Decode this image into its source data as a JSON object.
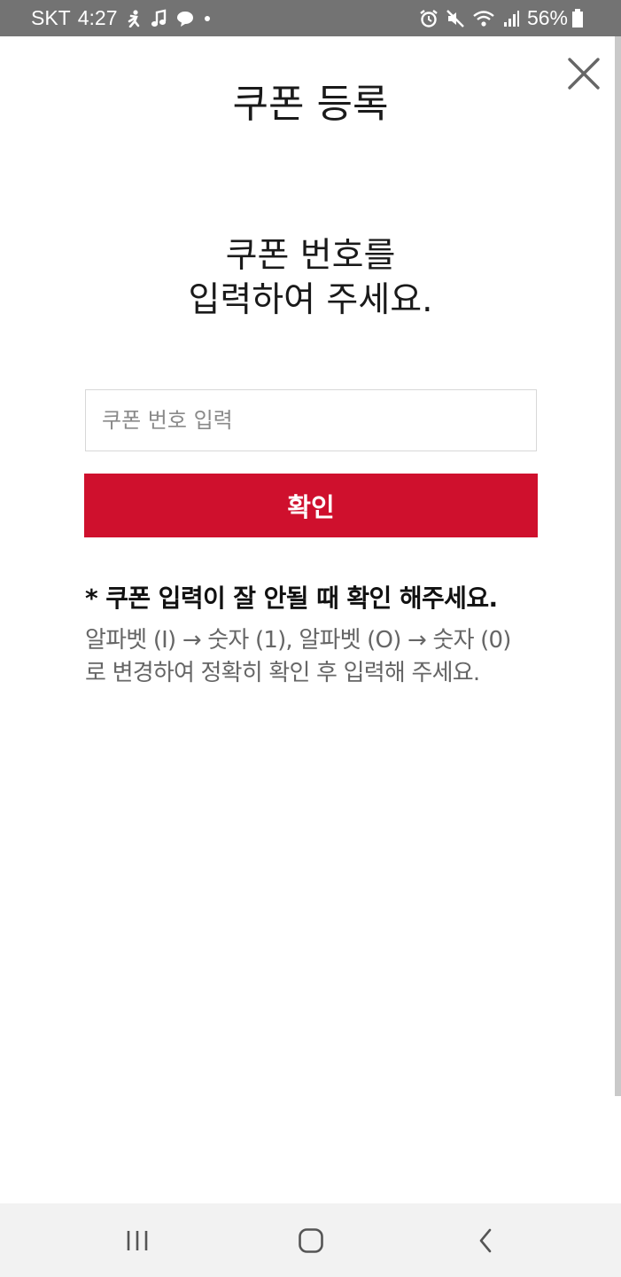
{
  "status_bar": {
    "carrier": "SKT",
    "time": "4:27",
    "battery": "56%",
    "icons_left": [
      "runner-icon",
      "music-note-icon",
      "chat-bubble-icon",
      "dot-icon"
    ],
    "icons_right": [
      "alarm-icon",
      "mute-icon",
      "wifi-icon",
      "signal-icon",
      "battery-icon"
    ]
  },
  "header": {
    "title": "쿠폰 등록",
    "close_icon": "close-icon"
  },
  "main": {
    "headline_line1": "쿠폰 번호를",
    "headline_line2": "입력하여 주세요.",
    "input": {
      "placeholder": "쿠폰 번호 입력",
      "value": ""
    },
    "confirm_label": "확인"
  },
  "notice": {
    "title": "* 쿠폰 입력이 잘 안될 때 확인 해주세요.",
    "line1": "알파벳 (I) → 숫자 (1), 알파벳 (O) → 숫자 (0)",
    "line2": "로 변경하여 정확히 확인 후 입력해 주세요."
  },
  "nav_bar": {
    "items": [
      "recent-apps-icon",
      "home-icon",
      "back-icon"
    ]
  },
  "colors": {
    "accent": "#cf102d",
    "status_bar": "#737373",
    "nav_bar": "#f2f2f2",
    "text_primary": "#1a1a1a",
    "text_secondary": "#666666"
  }
}
